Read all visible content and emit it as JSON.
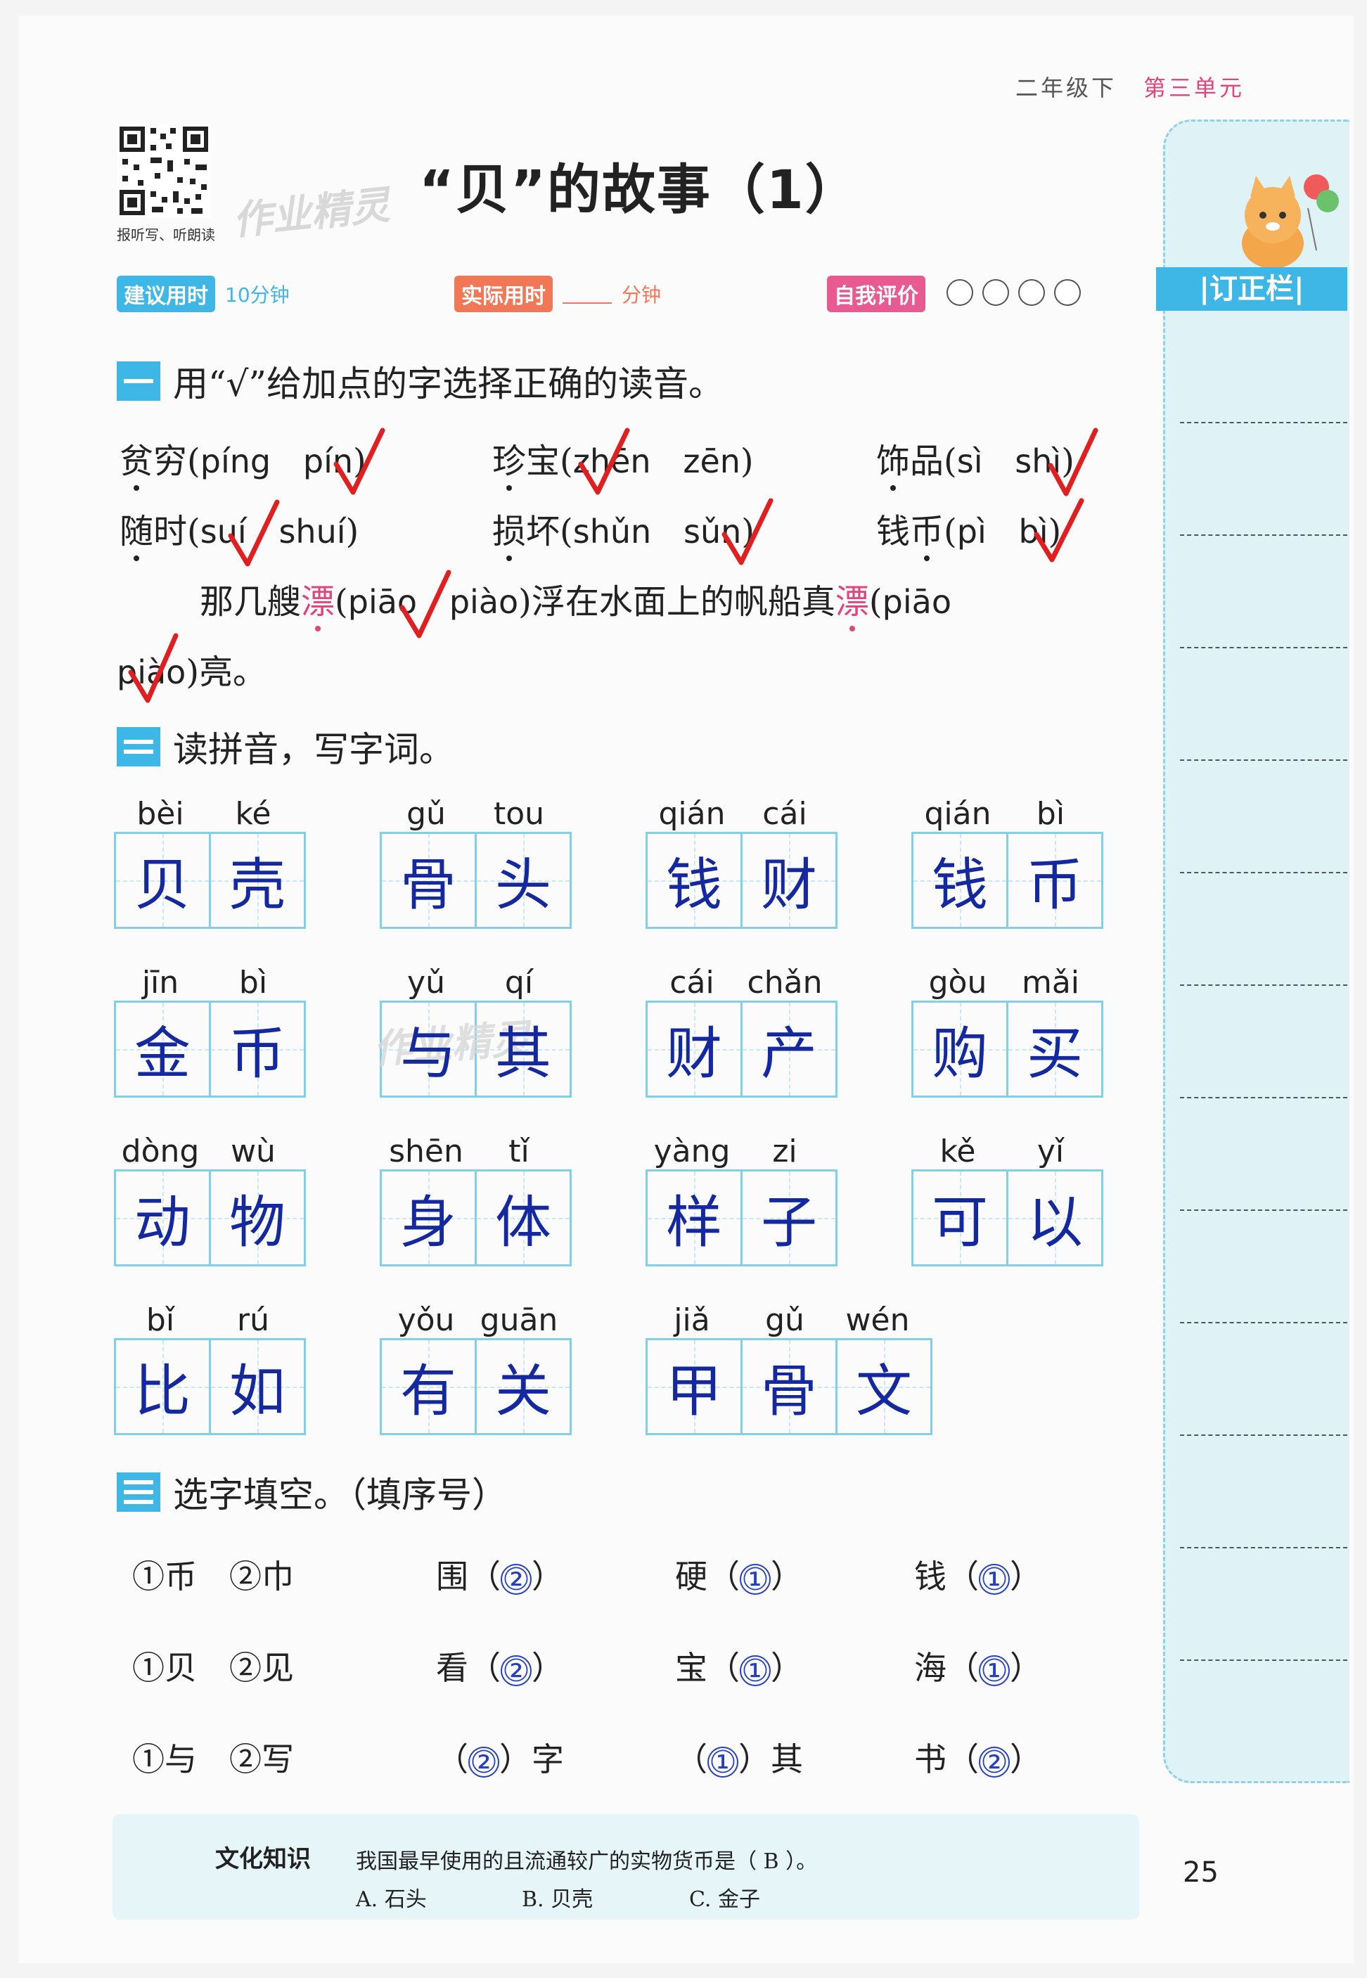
{
  "header": {
    "grade": "二年级下",
    "unit": "第三单元",
    "title": "“贝”的故事（1）",
    "qr_caption": "报听写、听朗读",
    "watermark": "作业精灵"
  },
  "time_bar": {
    "suggested_label": "建议用时",
    "suggested_value": "10分钟",
    "actual_label": "实际用时",
    "actual_unit": "分钟",
    "self_eval_label": "自我评价",
    "faces": [
      "smile-face-icon",
      "neutral-face-icon",
      "sad-face-icon",
      "cry-face-icon"
    ]
  },
  "sidebar": {
    "title": "|订正栏|"
  },
  "section1": {
    "title": "用“√”给加点的字选择正确的读音。",
    "items": [
      {
        "char_a": "贫",
        "char_b": "穷",
        "open": "(",
        "opt1": "píng",
        "opt2": "pín",
        "close": ")"
      },
      {
        "char_a": "珍",
        "char_b": "宝",
        "open": "(",
        "opt1": "zhēn",
        "opt2": "zēn",
        "close": ")"
      },
      {
        "char_a": "饰",
        "char_b": "品",
        "open": "(",
        "opt1": "sì",
        "opt2": "shì",
        "close": ")"
      },
      {
        "char_a": "随",
        "char_b": "时",
        "open": "(",
        "opt1": "suí",
        "opt2": "shuí",
        "close": ")"
      },
      {
        "char_a": "损",
        "char_b": "坏",
        "open": "(",
        "opt1": "shǔn",
        "opt2": "sǔn",
        "close": ")"
      },
      {
        "char_a": "钱",
        "char_b": "币",
        "open": "(",
        "opt1": "pì",
        "opt2": "bì",
        "close": ")"
      }
    ],
    "sentence": {
      "part1": "那几艘",
      "char1": "漂",
      "open1": "(",
      "opt1a": "piāo",
      "opt1b": "piào",
      "close1_text": ")浮在水面上的帆船真",
      "char2": "漂",
      "open2": "(",
      "opt2a": "piāo",
      "line2_opt2b": "piào",
      "line2_end": ")亮。"
    }
  },
  "section2": {
    "title": "读拼音，写字词。",
    "words": [
      {
        "pinyin": [
          "bèi",
          "ké"
        ],
        "chars": [
          "贝",
          "壳"
        ]
      },
      {
        "pinyin": [
          "gǔ",
          "tou"
        ],
        "chars": [
          "骨",
          "头"
        ]
      },
      {
        "pinyin": [
          "qián",
          "cái"
        ],
        "chars": [
          "钱",
          "财"
        ]
      },
      {
        "pinyin": [
          "qián",
          "bì"
        ],
        "chars": [
          "钱",
          "币"
        ]
      },
      {
        "pinyin": [
          "jīn",
          "bì"
        ],
        "chars": [
          "金",
          "币"
        ]
      },
      {
        "pinyin": [
          "yǔ",
          "qí"
        ],
        "chars": [
          "与",
          "其"
        ]
      },
      {
        "pinyin": [
          "cái",
          "chǎn"
        ],
        "chars": [
          "财",
          "产"
        ]
      },
      {
        "pinyin": [
          "gòu",
          "mǎi"
        ],
        "chars": [
          "购",
          "买"
        ]
      },
      {
        "pinyin": [
          "dòng",
          "wù"
        ],
        "chars": [
          "动",
          "物"
        ]
      },
      {
        "pinyin": [
          "shēn",
          "tǐ"
        ],
        "chars": [
          "身",
          "体"
        ]
      },
      {
        "pinyin": [
          "yàng",
          "zi"
        ],
        "chars": [
          "样",
          "子"
        ]
      },
      {
        "pinyin": [
          "kě",
          "yǐ"
        ],
        "chars": [
          "可",
          "以"
        ]
      },
      {
        "pinyin": [
          "bǐ",
          "rú"
        ],
        "chars": [
          "比",
          "如"
        ]
      },
      {
        "pinyin": [
          "yǒu",
          "guān"
        ],
        "chars": [
          "有",
          "关"
        ]
      },
      {
        "pinyin": [
          "jiǎ",
          "gǔ",
          "wén"
        ],
        "chars": [
          "甲",
          "骨",
          "文"
        ]
      }
    ]
  },
  "section3": {
    "title": "选字填空。（填序号）",
    "rows": [
      {
        "options": "①币　②巾",
        "blanks": [
          {
            "before": "围（",
            "answer": "②",
            "after": "）"
          },
          {
            "before": "硬（",
            "answer": "①",
            "after": "）"
          },
          {
            "before": "钱（",
            "answer": "①",
            "after": "）"
          }
        ]
      },
      {
        "options": "①贝　②见",
        "blanks": [
          {
            "before": "看（",
            "answer": "②",
            "after": "）"
          },
          {
            "before": "宝（",
            "answer": "①",
            "after": "）"
          },
          {
            "before": "海（",
            "answer": "①",
            "after": "）"
          }
        ]
      },
      {
        "options": "①与　②写",
        "blanks": [
          {
            "before": "（",
            "answer": "②",
            "after": "）字"
          },
          {
            "before": "（",
            "answer": "①",
            "after": "）其"
          },
          {
            "before": "书（",
            "answer": "②",
            "after": "）"
          }
        ]
      }
    ]
  },
  "culture": {
    "label": "文化知识",
    "question": "我国最早使用的且流通较广的实物货币是（ B ）。",
    "options": [
      "A. 石头",
      "B. 贝壳",
      "C. 金子"
    ]
  },
  "page_number": "25",
  "colors": {
    "accent_blue": "#3fb7e6",
    "answer_blue": "#1428a0",
    "check_red": "#e02020",
    "unit_pink": "#e0457b"
  }
}
